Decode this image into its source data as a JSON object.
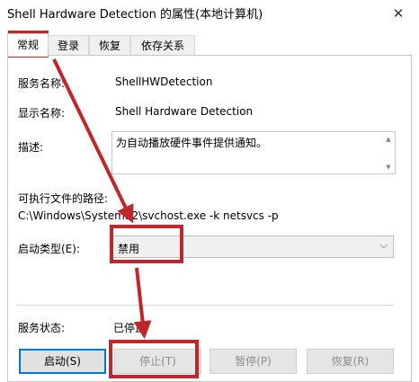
{
  "window": {
    "title": "Shell Hardware Detection 的属性(本地计算机)",
    "close_glyph": "✕"
  },
  "tabs": [
    {
      "label": "常规"
    },
    {
      "label": "登录"
    },
    {
      "label": "恢复"
    },
    {
      "label": "依存关系"
    }
  ],
  "general": {
    "service_name_label": "服务名称:",
    "service_name": "ShellHWDetection",
    "display_name_label": "显示名称:",
    "display_name": "Shell Hardware Detection",
    "description_label": "描述:",
    "description": "为自动播放硬件事件提供通知。",
    "exe_path_label": "可执行文件的路径:",
    "exe_path": "C:\\Windows\\System32\\svchost.exe -k netsvcs -p",
    "startup_type_label": "启动类型(E):",
    "startup_type": "禁用",
    "status_label": "服务状态:",
    "status": "已停止"
  },
  "buttons": {
    "start": "启动(S)",
    "stop": "停止(T)",
    "pause": "暂停(P)",
    "resume": "恢复(R)"
  },
  "annotation_color": "#c0272d"
}
